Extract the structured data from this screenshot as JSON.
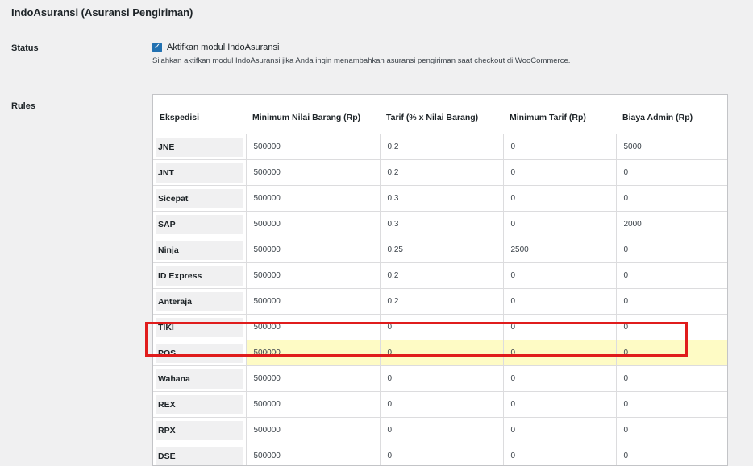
{
  "page": {
    "title": "IndoAsuransi (Asuransi Pengiriman)"
  },
  "status": {
    "label": "Status",
    "checkbox_checked": true,
    "checkbox_label": "Aktifkan modul IndoAsuransi",
    "description": "Silahkan aktifkan modul IndoAsuransi jika Anda ingin menambahkan asuransi pengiriman saat checkout di WooCommerce."
  },
  "rules": {
    "label": "Rules",
    "columns": [
      "Ekspedisi",
      "Minimum Nilai Barang (Rp)",
      "Tarif (% x Nilai Barang)",
      "Minimum Tarif (Rp)",
      "Biaya Admin (Rp)"
    ],
    "rows": [
      {
        "name": "JNE",
        "min_nilai": "500000",
        "tarif": "0.2",
        "min_tarif": "0",
        "admin": "5000"
      },
      {
        "name": "JNT",
        "min_nilai": "500000",
        "tarif": "0.2",
        "min_tarif": "0",
        "admin": "0"
      },
      {
        "name": "Sicepat",
        "min_nilai": "500000",
        "tarif": "0.3",
        "min_tarif": "0",
        "admin": "0"
      },
      {
        "name": "SAP",
        "min_nilai": "500000",
        "tarif": "0.3",
        "min_tarif": "0",
        "admin": "2000"
      },
      {
        "name": "Ninja",
        "min_nilai": "500000",
        "tarif": "0.25",
        "min_tarif": "2500",
        "admin": "0"
      },
      {
        "name": "ID Express",
        "min_nilai": "500000",
        "tarif": "0.2",
        "min_tarif": "0",
        "admin": "0"
      },
      {
        "name": "Anteraja",
        "min_nilai": "500000",
        "tarif": "0.2",
        "min_tarif": "0",
        "admin": "0"
      },
      {
        "name": "TIKI",
        "min_nilai": "500000",
        "tarif": "0",
        "min_tarif": "0",
        "admin": "0"
      },
      {
        "name": "POS",
        "min_nilai": "500000",
        "tarif": "0",
        "min_tarif": "0",
        "admin": "0",
        "highlighted": true
      },
      {
        "name": "Wahana",
        "min_nilai": "500000",
        "tarif": "0",
        "min_tarif": "0",
        "admin": "0"
      },
      {
        "name": "REX",
        "min_nilai": "500000",
        "tarif": "0",
        "min_tarif": "0",
        "admin": "0"
      },
      {
        "name": "RPX",
        "min_nilai": "500000",
        "tarif": "0",
        "min_tarif": "0",
        "admin": "0"
      },
      {
        "name": "DSE",
        "min_nilai": "500000",
        "tarif": "0",
        "min_tarif": "0",
        "admin": "0"
      }
    ]
  },
  "colors": {
    "accent": "#2271b1",
    "highlight_fill": "#fefbc5",
    "highlight_border": "#e01c1c"
  }
}
